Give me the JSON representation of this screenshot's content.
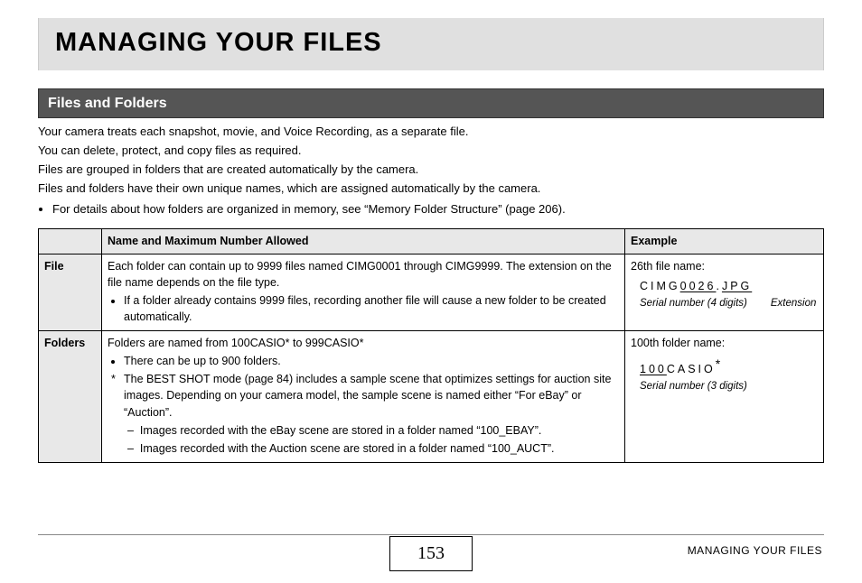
{
  "title": "MANAGING YOUR FILES",
  "section": "Files and Folders",
  "intro": {
    "p1": "Your camera treats each snapshot, movie, and Voice Recording, as a separate file.",
    "p2": "You can delete, protect, and copy files as required.",
    "p3": "Files are grouped in folders that are created automatically by the camera.",
    "p4": "Files and folders have their own unique names, which are assigned automatically by the camera.",
    "bullet": "For details about how folders are organized in memory, see “Memory Folder Structure” (page 206)."
  },
  "table": {
    "headers": {
      "h0": "",
      "h1": "Name and Maximum Number Allowed",
      "h2": "Example"
    },
    "file": {
      "label": "File",
      "desc_main": "Each folder can contain up to 9999 files named CIMG0001 through CIMG9999. The extension on the file name depends on the file type.",
      "desc_bullet": "If a folder already contains 9999 files, recording another file will cause a new folder to be created automatically.",
      "ex_title": "26th file name:",
      "ex_prefix": "CIMG",
      "ex_serial": "0026",
      "ex_dot": ".",
      "ex_ext": "JPG",
      "ex_lbl_serial": "Serial number (4 digits)",
      "ex_lbl_ext": "Extension"
    },
    "folders": {
      "label": "Folders",
      "line1_a": "Folders are named from 100CASIO",
      "line1_b": " to 999CASIO",
      "bullet1": "There can be up to 900 folders.",
      "star_note": "The BEST SHOT mode (page 84) includes a sample scene that optimizes settings for auction site images. Depending on your camera model, the sample scene is named either “For eBay” or “Auction”.",
      "dash1": "Images recorded with the eBay scene are stored in a folder named “100_EBAY”.",
      "dash2": "Images recorded with the Auction scene are stored in a folder named “100_AUCT”.",
      "ex_title": "100th folder name:",
      "ex_serial": "100",
      "ex_rest": "CASIO",
      "ex_lbl": "Serial number (3 digits)"
    }
  },
  "footer": {
    "page": "153",
    "label": "MANAGING YOUR FILES"
  }
}
